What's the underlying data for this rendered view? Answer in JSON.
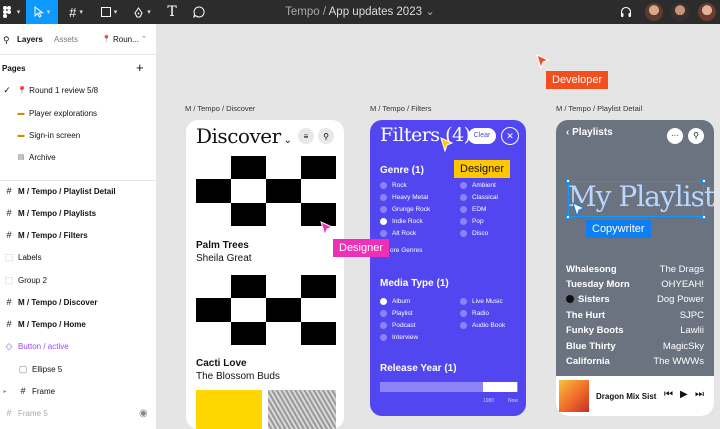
{
  "toolbar": {
    "project": "Tempo",
    "separator": "/",
    "file": "App updates 2023",
    "file_caret": "⌄"
  },
  "sidebar": {
    "tabs": {
      "layers": "Layers",
      "assets": "Assets",
      "page": "Roun..."
    },
    "pages_header": "Pages",
    "add_page": "+",
    "pages": [
      {
        "label": "📍 Round 1 review 5/8"
      },
      {
        "label": "Player explorations"
      },
      {
        "label": "Sign-in screen"
      },
      {
        "label": "Archive"
      }
    ],
    "layers": [
      {
        "label": "M / Tempo / Playlist Detail"
      },
      {
        "label": "M / Tempo / Playlists"
      },
      {
        "label": "M / Tempo / Filters"
      },
      {
        "label": "Labels"
      },
      {
        "label": "Group 2"
      },
      {
        "label": "M / Tempo / Discover"
      },
      {
        "label": "M / Tempo / Home"
      },
      {
        "label": "Button / active"
      },
      {
        "label": "Ellipse 5"
      },
      {
        "label": "Frame"
      },
      {
        "label": "Frame 5"
      }
    ]
  },
  "canvas": {
    "frame_labels": {
      "discover": "M / Tempo / Discover",
      "filters": "M / Tempo / Filters",
      "playlist": "M / Tempo / Playlist Detail"
    },
    "discover": {
      "title": "Discover",
      "tracks": [
        {
          "title": "Palm Trees",
          "artist": "Sheila Great"
        },
        {
          "title": "Cacti Love",
          "artist": "The Blossom Buds"
        }
      ]
    },
    "filters": {
      "title": "Filters (4)",
      "clear": "Clear",
      "genre_heading": "Genre (1)",
      "genres_left": [
        "Rock",
        "Heavy Metal",
        "Grunge Rock",
        "Indie Rock",
        "Alt Rock"
      ],
      "genres_right": [
        "Ambient",
        "Classical",
        "EDM",
        "Pop",
        "Disco"
      ],
      "more_genres": "ore Genres",
      "media_heading": "Media Type (1)",
      "media_left": [
        "Album",
        "Playlist",
        "Podcast",
        "Interview"
      ],
      "media_right": [
        "Live Music",
        "Radio",
        "Audio Book"
      ],
      "release_heading": "Release Year (1)",
      "range_from": "1980",
      "range_to": "Now"
    },
    "playlist": {
      "back": "Playlists",
      "title": "My Playlist",
      "songs": [
        {
          "title": "Whalesong",
          "artist": "The Drags"
        },
        {
          "title": "Tuesday Morn",
          "artist": "OHYEAH!"
        },
        {
          "title": "Sisters",
          "artist": "Dog Power"
        },
        {
          "title": "The Hurt",
          "artist": "SJPC"
        },
        {
          "title": "Funky Boots",
          "artist": "Lawlii"
        },
        {
          "title": "Blue Thirty",
          "artist": "MagicSky"
        },
        {
          "title": "California",
          "artist": "The WWWs"
        }
      ],
      "now_playing": "Dragon Mix Sist"
    },
    "cursors": {
      "developer": "Developer",
      "designer_1": "Designer",
      "designer_2": "Designer",
      "copywriter": "Copywriter"
    }
  },
  "colors": {
    "toolbar_bg": "#2c2c2c",
    "accent_blue": "#0d99ff",
    "filters_bg": "#5146f0",
    "playlist_bg": "#6b7280",
    "developer": "#f24e1e",
    "designer_pink": "#ee2fb8",
    "designer_yellow": "#ffc700",
    "copywriter": "#0d7ff2"
  }
}
